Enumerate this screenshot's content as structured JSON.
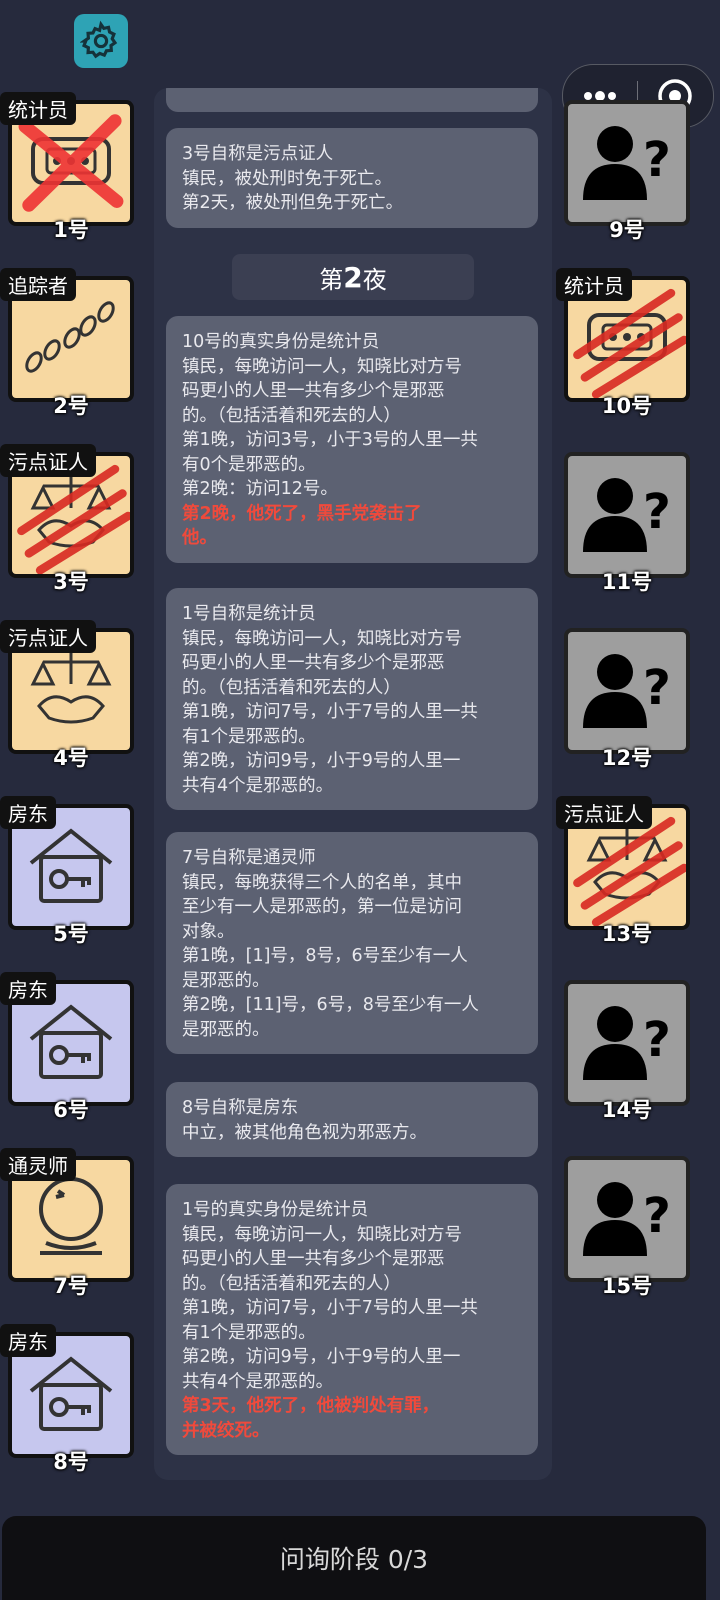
{
  "header": {
    "settings_icon": "gear-icon",
    "menu_icon": "more-dots-icon",
    "close_icon": "target-circle-icon"
  },
  "left_players": [
    {
      "role": "统计员",
      "num": "1号",
      "icon": "calculator-icon",
      "bg": "tan",
      "mark": "x"
    },
    {
      "role": "追踪者",
      "num": "2号",
      "icon": "footprints-icon",
      "bg": "tan",
      "mark": ""
    },
    {
      "role": "污点证人",
      "num": "3号",
      "icon": "scales-handshake-icon",
      "bg": "tan",
      "mark": "claw"
    },
    {
      "role": "污点证人",
      "num": "4号",
      "icon": "scales-handshake-icon",
      "bg": "tan",
      "mark": ""
    },
    {
      "role": "房东",
      "num": "5号",
      "icon": "house-key-icon",
      "bg": "lav",
      "mark": ""
    },
    {
      "role": "房东",
      "num": "6号",
      "icon": "house-key-icon",
      "bg": "lav",
      "mark": ""
    },
    {
      "role": "通灵师",
      "num": "7号",
      "icon": "crystal-ball-icon",
      "bg": "tan",
      "mark": ""
    },
    {
      "role": "房东",
      "num": "8号",
      "icon": "house-key-icon",
      "bg": "lav",
      "mark": ""
    }
  ],
  "right_players": [
    {
      "role": "",
      "num": "9号",
      "icon": "unknown-person-icon",
      "bg": "grey",
      "mark": ""
    },
    {
      "role": "统计员",
      "num": "10号",
      "icon": "calculator-icon",
      "bg": "tan",
      "mark": "claw"
    },
    {
      "role": "",
      "num": "11号",
      "icon": "unknown-person-icon",
      "bg": "grey",
      "mark": ""
    },
    {
      "role": "",
      "num": "12号",
      "icon": "unknown-person-icon",
      "bg": "grey",
      "mark": ""
    },
    {
      "role": "污点证人",
      "num": "13号",
      "icon": "scales-handshake-icon",
      "bg": "tan",
      "mark": "claw"
    },
    {
      "role": "",
      "num": "14号",
      "icon": "unknown-person-icon",
      "bg": "grey",
      "mark": ""
    },
    {
      "role": "",
      "num": "15号",
      "icon": "unknown-person-icon",
      "bg": "grey",
      "mark": ""
    }
  ],
  "log": {
    "night_label_prefix": "第",
    "night_label_num": "2",
    "night_label_suffix": "夜",
    "entries": [
      {
        "lines": [
          "3号自称是污点证人",
          "镇民，被处刑时免于死亡。",
          "第2天，被处刑但免于死亡。"
        ],
        "red": []
      },
      {
        "lines": [
          "10号的真实身份是统计员",
          "镇民，每晚访问一人，知晓比对方号",
          "码更小的人里一共有多少个是邪恶",
          "的。（包括活着和死去的人）",
          "第1晚，访问3号，小于3号的人里一共",
          "有0个是邪恶的。",
          "第2晚：访问12号。"
        ],
        "red": [
          "第2晚，他死了，黑手党袭击了",
          "他。"
        ]
      },
      {
        "lines": [
          "1号自称是统计员",
          "镇民，每晚访问一人，知晓比对方号",
          "码更小的人里一共有多少个是邪恶",
          "的。（包括活着和死去的人）",
          "第1晚，访问7号，小于7号的人里一共",
          "有1个是邪恶的。",
          "第2晚，访问9号，小于9号的人里一",
          "共有4个是邪恶的。"
        ],
        "red": []
      },
      {
        "lines": [
          "7号自称是通灵师",
          "镇民，每晚获得三个人的名单，其中",
          "至少有一人是邪恶的，第一位是访问",
          "对象。",
          "第1晚，[1]号，8号，6号至少有一人",
          "是邪恶的。",
          "第2晚，[11]号，6号，8号至少有一人",
          "是邪恶的。"
        ],
        "red": []
      },
      {
        "lines": [
          "8号自称是房东",
          "中立，被其他角色视为邪恶方。"
        ],
        "red": []
      },
      {
        "lines": [
          "1号的真实身份是统计员",
          "镇民，每晚访问一人，知晓比对方号",
          "码更小的人里一共有多少个是邪恶",
          "的。（包括活着和死去的人）",
          "第1晚，访问7号，小于7号的人里一共",
          "有1个是邪恶的。",
          "第2晚，访问9号，小于9号的人里一",
          "共有4个是邪恶的。"
        ],
        "red": [
          "第3天，他死了，他被判处有罪，",
          "并被绞死。"
        ]
      }
    ]
  },
  "footer": {
    "phase_label": "问询阶段 0/3"
  },
  "colors": {
    "background": "#262a3d",
    "card_tan": "#f7d8a1",
    "card_lavender": "#c6c7ee",
    "card_grey": "#9e9e9e",
    "death_text": "#f04a3c",
    "settings_bg": "#2ea3b5"
  }
}
